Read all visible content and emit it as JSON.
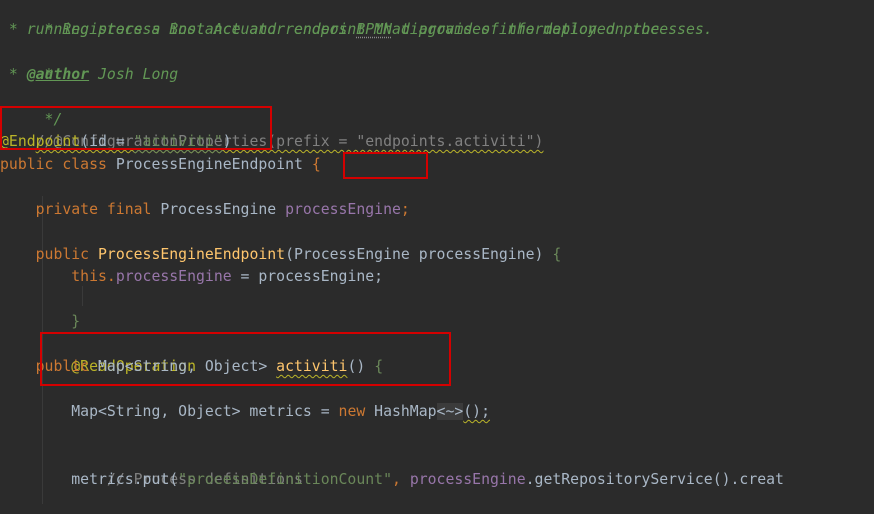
{
  "code": {
    "l1": " * Registers a Boot Actuator endpoint that provides information on the",
    "l2a": " * running process instance and renders ",
    "l2b": "BPMN",
    "l2c": " diagrams of the deployed processes.",
    "l3": " *",
    "l4a": " * ",
    "l4b": "@author",
    "l4c": " Josh Long",
    "l5": " */",
    "l6": "//@ConfigurationProperties(prefix = \"endpoints.activiti\")",
    "l7a": "@Endpoint",
    "l7b": "(id = ",
    "l7c": "\"activiti\"",
    "l7d": ")",
    "l8a": "public class ",
    "l8b": "ProcessEngineEndpoint ",
    "l8c": "{",
    "l10a": "    private final ",
    "l10b": "ProcessEngine ",
    "l10c": "processEngine",
    "l10d": ";",
    "l12a": "    public ",
    "l12b": "ProcessEngineEndpoint",
    "l12c": "(ProcessEngine processEngine) ",
    "l12d": "{",
    "l13a": "        this",
    "l13b": ".",
    "l13c": "processEngine",
    "l13d": " = processEngine;",
    "l14": "    }",
    "l16": "    @ReadOperation",
    "l17a": "    public ",
    "l17b": "Map<String, Object> ",
    "l17c": "activiti",
    "l17d": "() ",
    "l17e": "{",
    "l19a": "        Map<String, Object> metrics = ",
    "l19b": "new ",
    "l19c": "HashMap",
    "l19d": "<~>",
    "l19e": "();",
    "l21": "        // Process definitions",
    "l22a": "        metrics.put(",
    "l22b": "\"processDefinitionCount\"",
    "l22c": ", ",
    "l22d": "processEngine",
    "l22e": ".getRepositoryService().creat"
  },
  "colors": {
    "background": "#2b2b2b",
    "highlight_box": "#d40000",
    "keyword": "#cc7832",
    "annotation": "#bbb529",
    "string": "#6a8759",
    "doc_comment": "#629755",
    "field": "#9876aa",
    "method": "#ffc66d"
  }
}
